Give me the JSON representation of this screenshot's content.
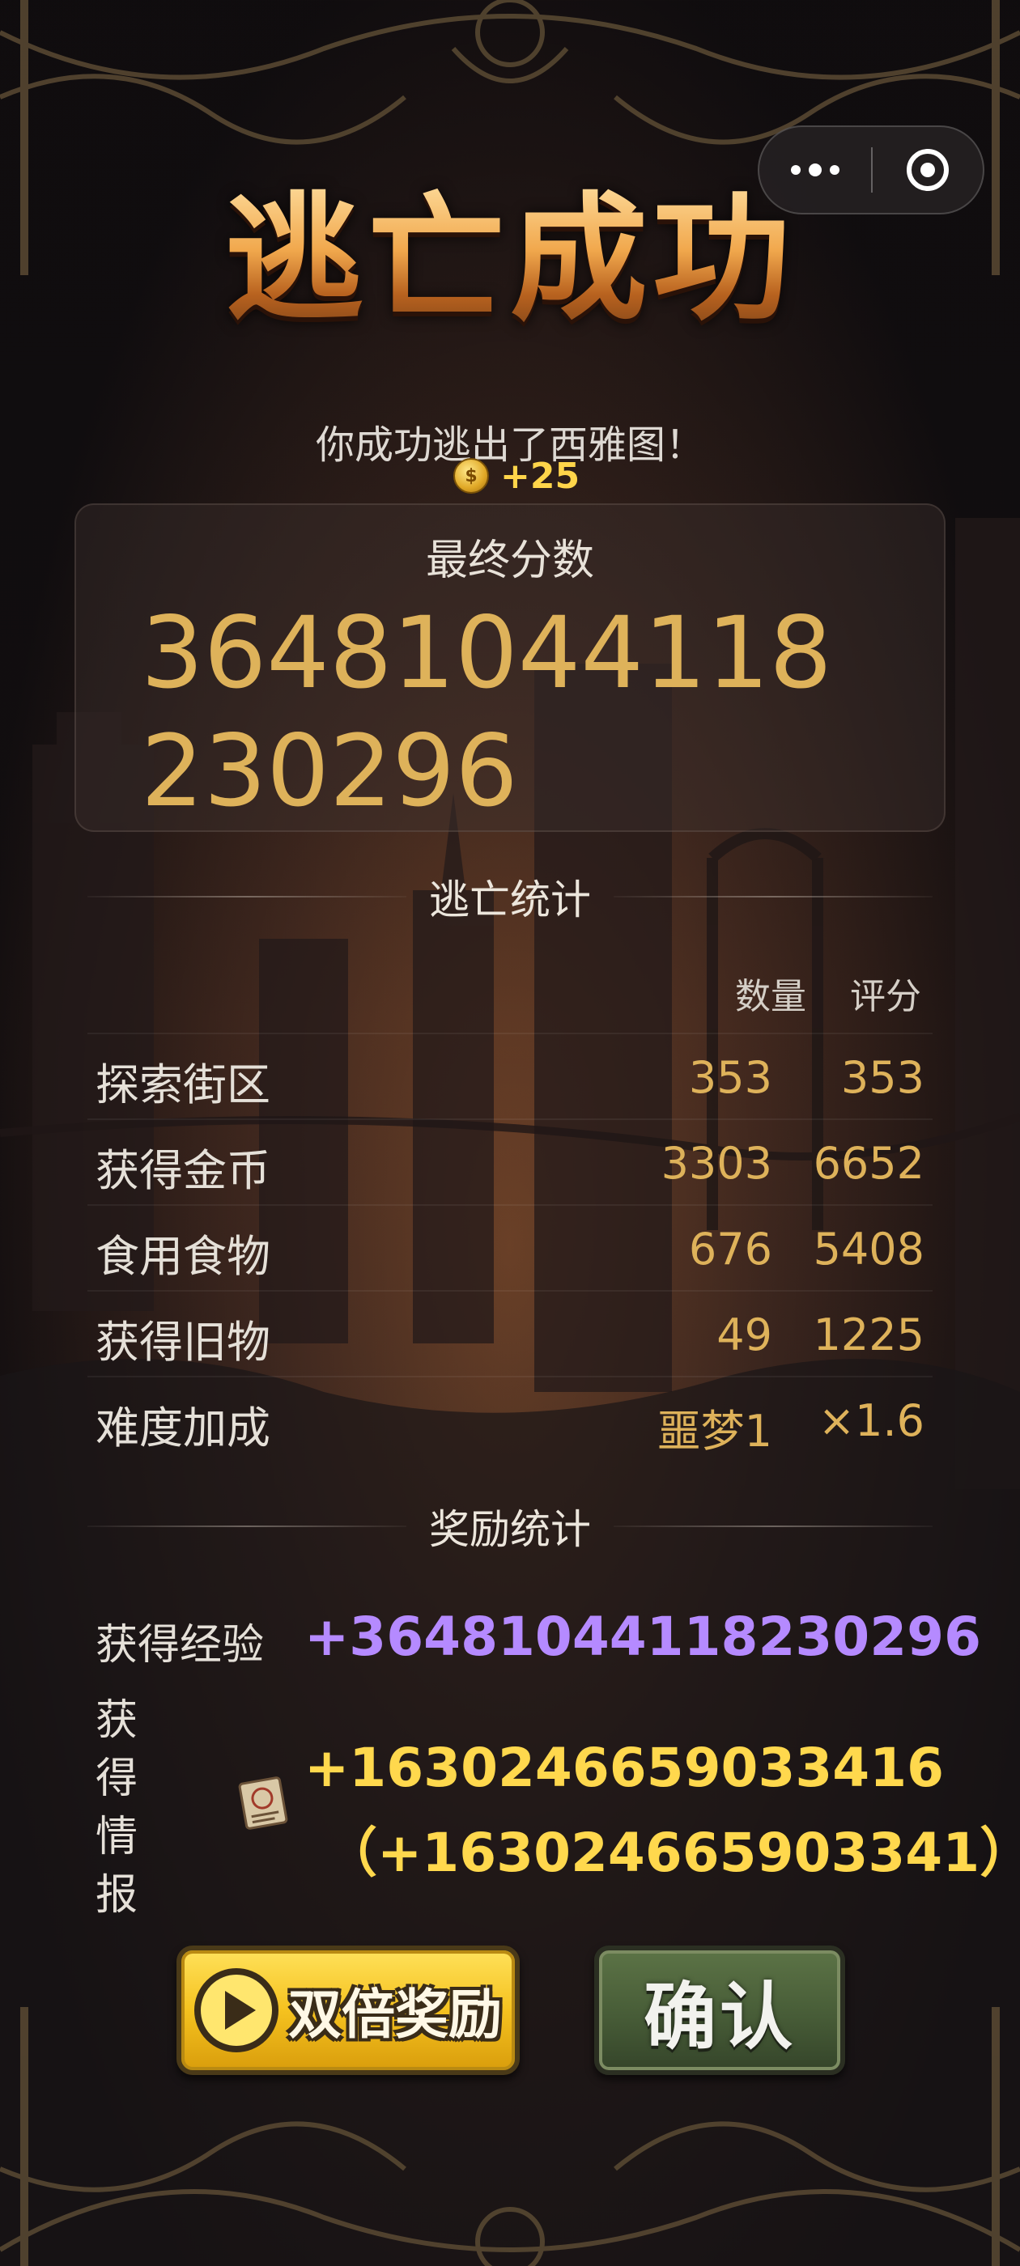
{
  "window": {
    "title": "逃亡成功",
    "subtitle": "你成功逃出了西雅图！"
  },
  "coin_gain": {
    "coin_glyph": "$",
    "amount": "+25"
  },
  "final_score": {
    "label": "最终分数",
    "value": "36481044118230296"
  },
  "escape_stats": {
    "header": "逃亡统计",
    "columns": {
      "quantity": "数量",
      "score": "评分"
    },
    "rows": [
      {
        "name": "探索街区",
        "quantity": "353",
        "score": "353"
      },
      {
        "name": "获得金币",
        "quantity": "3303",
        "score": "6652"
      },
      {
        "name": "食用食物",
        "quantity": "676",
        "score": "5408"
      },
      {
        "name": "获得旧物",
        "quantity": "49",
        "score": "1225"
      },
      {
        "name": "难度加成",
        "quantity": "噩梦1",
        "score": "×1.6"
      }
    ]
  },
  "reward_stats": {
    "header": "奖励统计",
    "exp_label": "获得经验",
    "exp_value": "+36481044118230296",
    "intel_label": [
      "获",
      "得",
      "情",
      "报"
    ],
    "intel_icon": "intel-document-icon",
    "intel_value": "+16302466590334​16",
    "intel_bonus": "（+1630246659033​41）"
  },
  "buttons": {
    "double_reward": "双倍奖励",
    "confirm": "确认"
  },
  "colors": {
    "gold": "#deb25a",
    "exp_purple": "#b58aff",
    "intel_yellow": "#ffd84d",
    "button_yellow": "#f5c21f",
    "button_green": "#475c37"
  }
}
